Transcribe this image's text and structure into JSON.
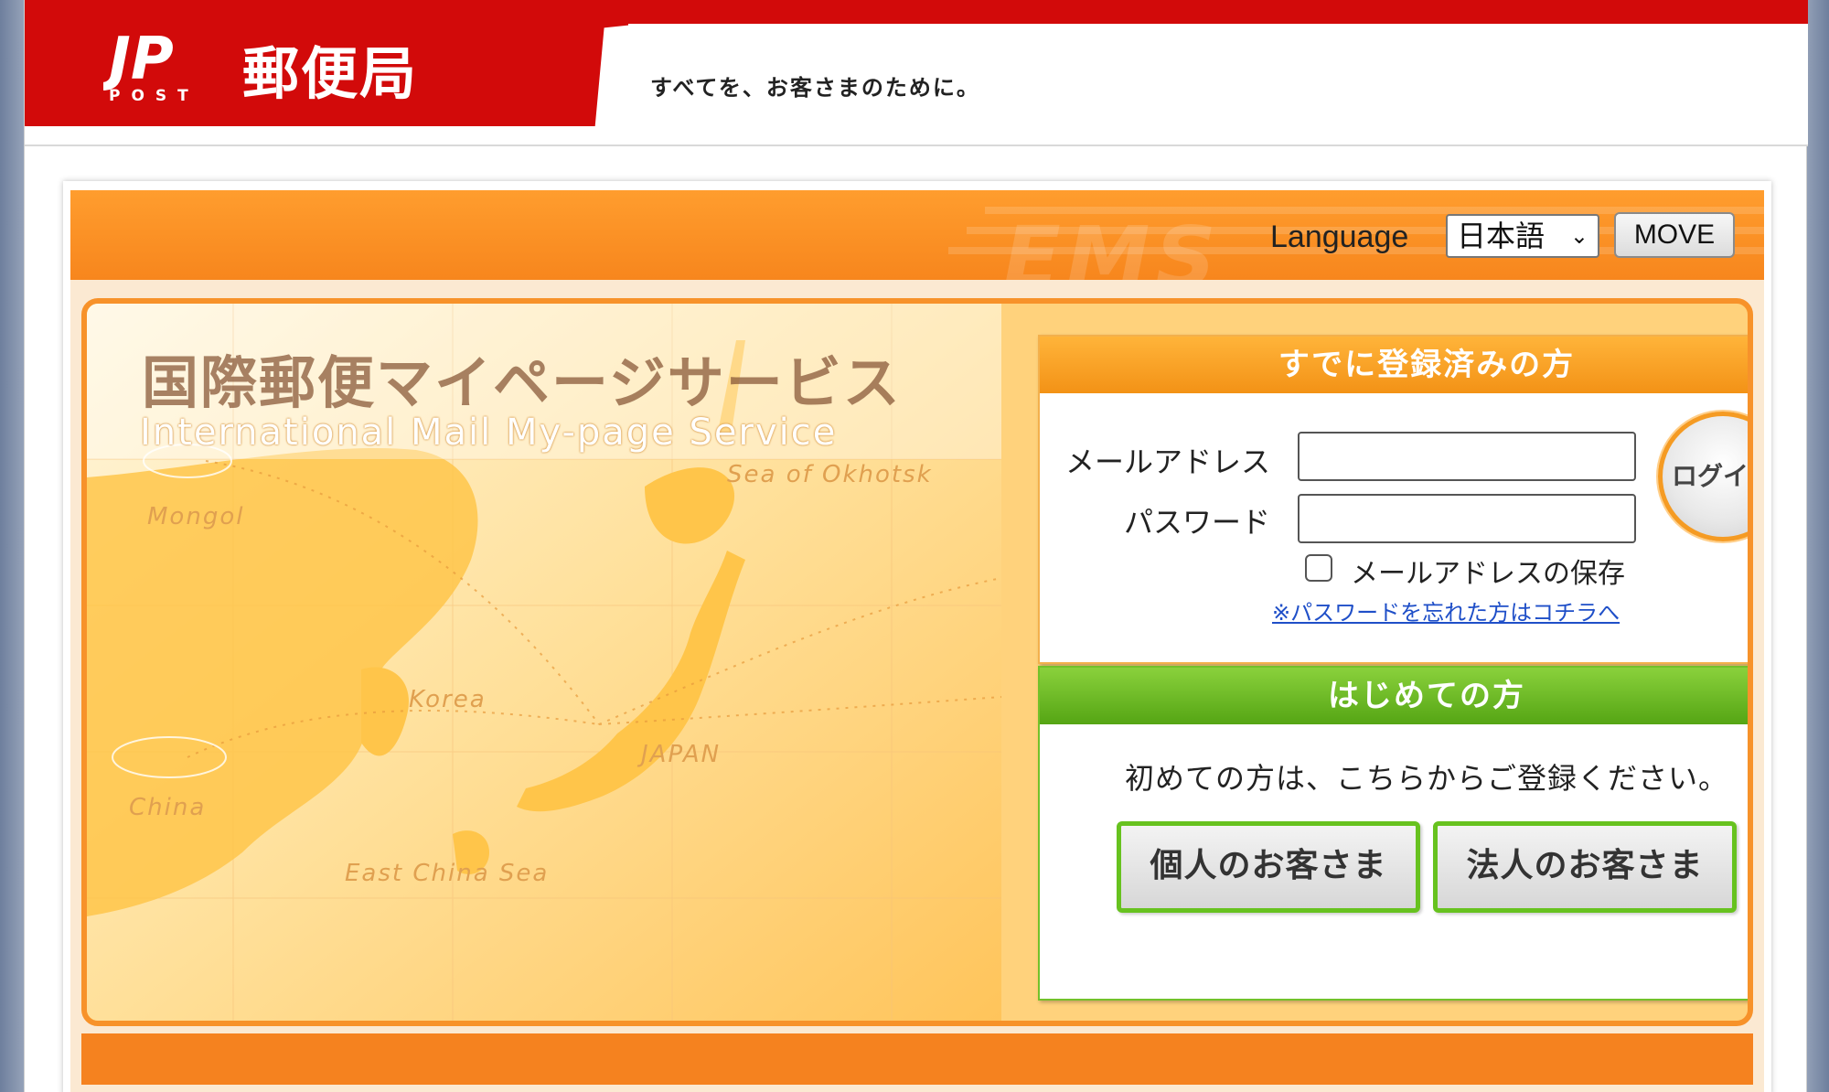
{
  "header": {
    "logo_mark": "JP",
    "logo_sub": "POST",
    "logo_text": "郵便局",
    "tagline": "すべてを、お客さまのために。"
  },
  "language_bar": {
    "label": "Language",
    "selected_language": "日本語",
    "move_button": "MOVE",
    "watermark": "EMS"
  },
  "hero": {
    "title": "国際郵便マイページサービス",
    "subtitle": "International Mail My-page Service",
    "map_labels": [
      "Sea of Okhotsk",
      "Mongol",
      "Korea",
      "JAPAN",
      "China",
      "East China Sea"
    ]
  },
  "login": {
    "header": "すでに登録済みの方",
    "email_label": "メールアドレス",
    "password_label": "パスワード",
    "email_value": "",
    "password_value": "",
    "login_button": "ログイン",
    "save_email_label": "メールアドレスの保存",
    "forgot_link": "※パスワードを忘れた方はコチラへ"
  },
  "register": {
    "header": "はじめての方",
    "text": "初めての方は、こちらからご登録ください。",
    "personal_button": "個人のお客さま",
    "corporate_button": "法人のお客さま"
  },
  "colors": {
    "brand_red": "#d20a0a",
    "orange": "#f7861d",
    "green": "#67c21f",
    "link_blue": "#1f4fc8"
  }
}
